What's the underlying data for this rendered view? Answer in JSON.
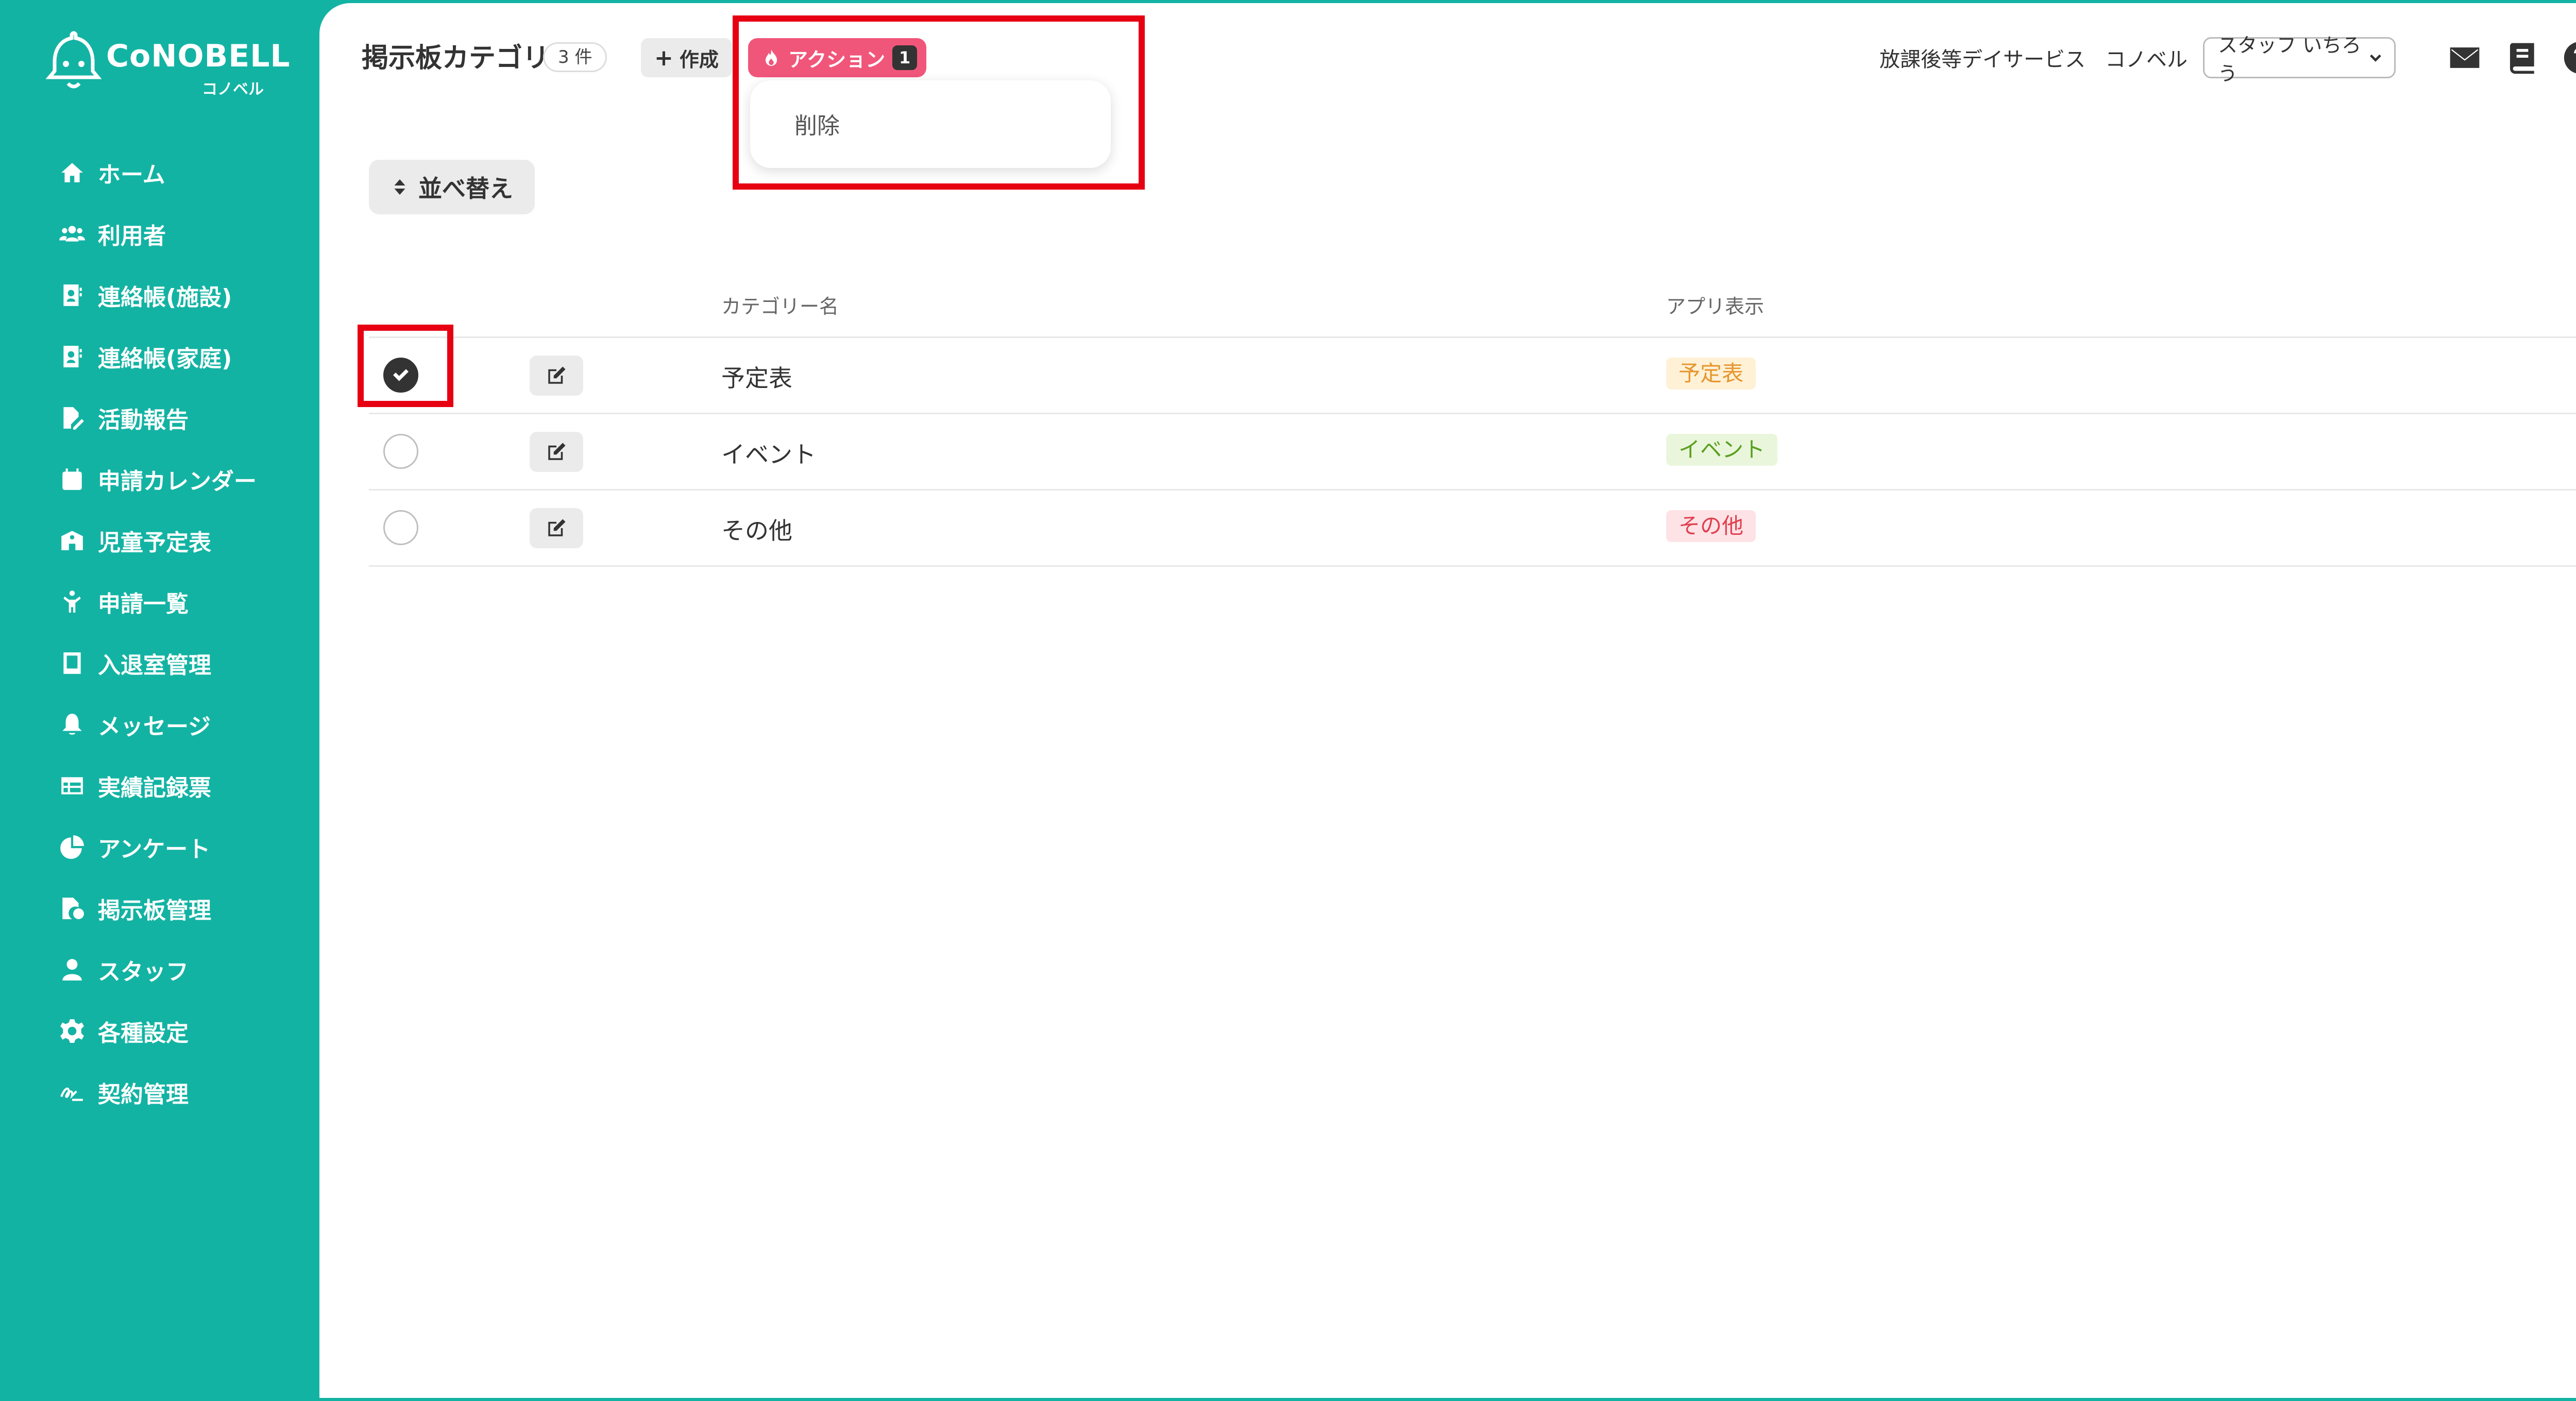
{
  "brand": {
    "name": "CoNOBELL",
    "sub": "コノベル"
  },
  "sidebar": {
    "items": [
      {
        "label": "ホーム",
        "icon": "home-icon"
      },
      {
        "label": "利用者",
        "icon": "users-icon"
      },
      {
        "label": "連絡帳(施設)",
        "icon": "contact-book-icon"
      },
      {
        "label": "連絡帳(家庭)",
        "icon": "contact-book-icon"
      },
      {
        "label": "活動報告",
        "icon": "report-icon"
      },
      {
        "label": "申請カレンダー",
        "icon": "calendar-icon"
      },
      {
        "label": "児童予定表",
        "icon": "school-icon"
      },
      {
        "label": "申請一覧",
        "icon": "child-icon"
      },
      {
        "label": "入退室管理",
        "icon": "tablet-icon"
      },
      {
        "label": "メッセージ",
        "icon": "bell-icon"
      },
      {
        "label": "実績記録票",
        "icon": "table-icon"
      },
      {
        "label": "アンケート",
        "icon": "pie-chart-icon"
      },
      {
        "label": "掲示板管理",
        "icon": "board-icon"
      },
      {
        "label": "スタッフ",
        "icon": "staff-icon"
      },
      {
        "label": "各種設定",
        "icon": "gear-icon"
      },
      {
        "label": "契約管理",
        "icon": "signature-icon"
      }
    ]
  },
  "header": {
    "title": "掲示板カテゴリ",
    "count": "3 件",
    "create_label": "作成",
    "action_label": "アクション",
    "action_count": "1",
    "dropdown": {
      "delete_label": "削除"
    },
    "sort_label": "並べ替え",
    "org_name": "放課後等デイサービス",
    "org_short": "コノベル",
    "user_select": "スタッフ いちろう"
  },
  "table": {
    "columns": {
      "name": "カテゴリー名",
      "app_display": "アプリ表示"
    },
    "rows": [
      {
        "name": "予定表",
        "tag": "予定表",
        "checked": true,
        "tag_bg": "#fff1d6",
        "tag_color": "#e5962e"
      },
      {
        "name": "イベント",
        "tag": "イベント",
        "checked": false,
        "tag_bg": "#eaf6dc",
        "tag_color": "#5aa020"
      },
      {
        "name": "その他",
        "tag": "その他",
        "checked": false,
        "tag_bg": "#fde3e6",
        "tag_color": "#e0404f"
      }
    ]
  },
  "colors": {
    "primary": "#13b3a3",
    "action": "#f0567a",
    "highlight": "#e60012"
  }
}
